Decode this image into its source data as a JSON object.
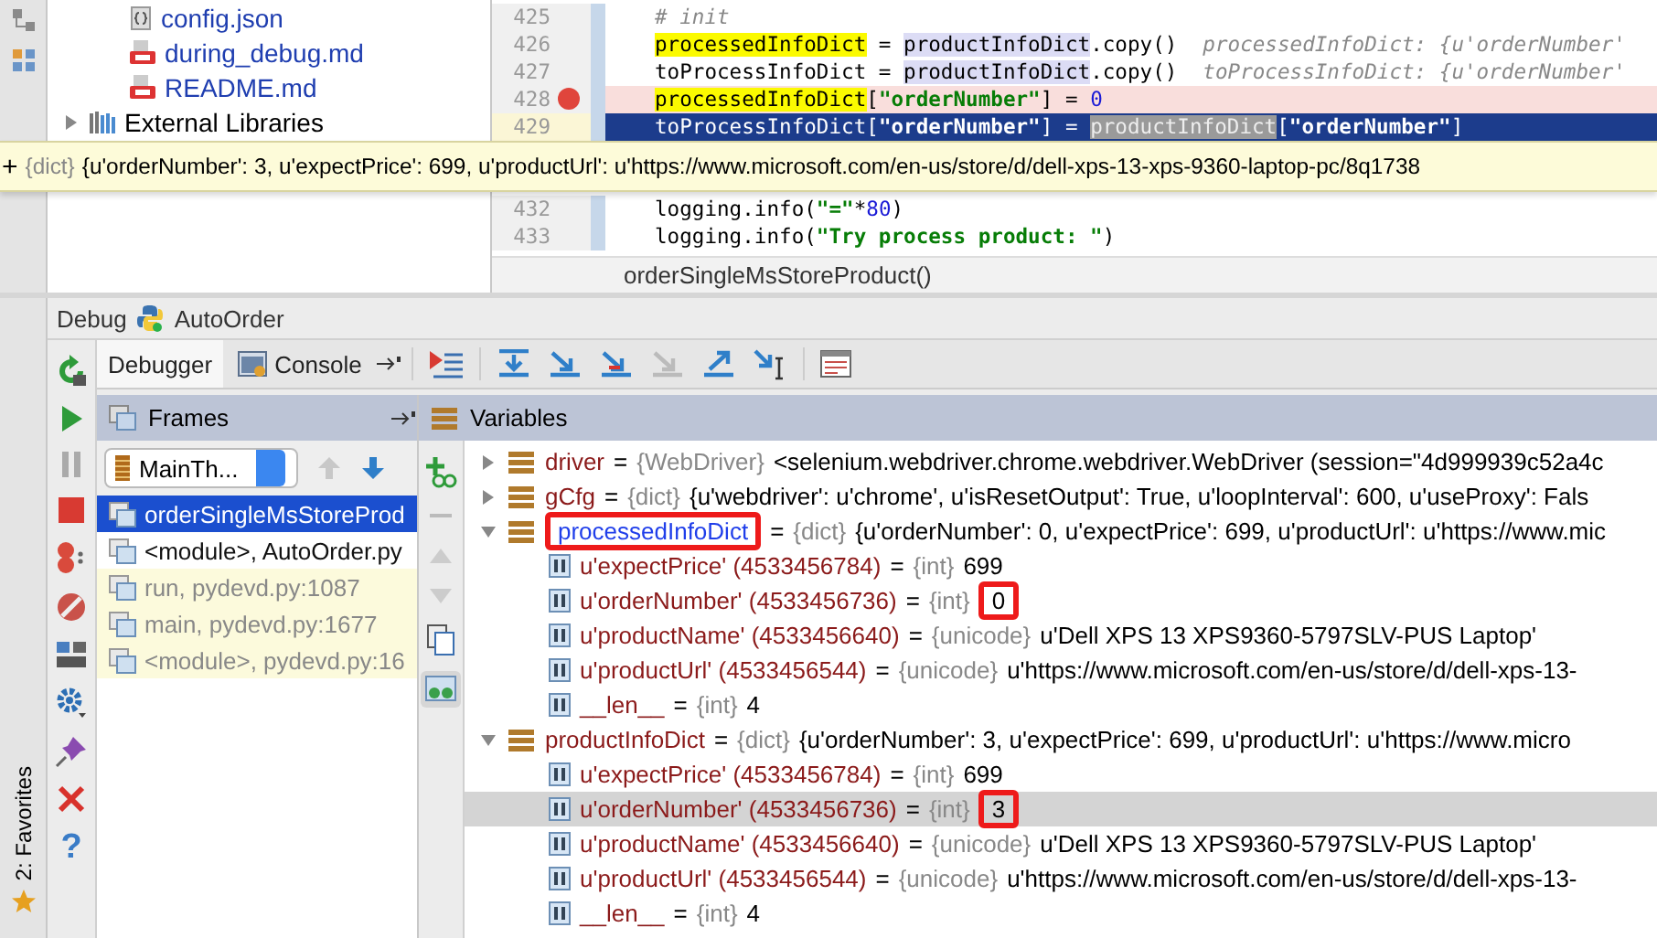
{
  "project_tree": {
    "items": [
      {
        "name": "config.json",
        "kind": "json",
        "modified": true
      },
      {
        "name": "during_debug.md",
        "kind": "md",
        "modified": true
      },
      {
        "name": "README.md",
        "kind": "md",
        "modified": true
      },
      {
        "name": "External Libraries",
        "kind": "library",
        "modified": false,
        "expanded": false
      }
    ]
  },
  "editor": {
    "lines": [
      {
        "number": "425",
        "breakpoint": false,
        "current": false,
        "segments": [
          {
            "text": "# init",
            "kind": "comment"
          }
        ]
      },
      {
        "number": "426",
        "breakpoint": false,
        "current": false,
        "segments": [
          {
            "text": "processedInfoDict",
            "kind": "assign"
          },
          {
            "text": " = ",
            "kind": "plain"
          },
          {
            "text": "productInfoDict",
            "kind": "ref"
          },
          {
            "text": ".copy()",
            "kind": "plain"
          },
          {
            "text": "processedInfoDict: {u'orderNumber'",
            "kind": "hint"
          }
        ]
      },
      {
        "number": "427",
        "breakpoint": false,
        "current": false,
        "segments": [
          {
            "text": "toProcessInfoDict",
            "kind": "plain"
          },
          {
            "text": " = ",
            "kind": "plain"
          },
          {
            "text": "productInfoDict",
            "kind": "ref"
          },
          {
            "text": ".copy()",
            "kind": "plain"
          },
          {
            "text": "toProcessInfoDict: {u'orderNumber'",
            "kind": "hint"
          }
        ]
      },
      {
        "number": "428",
        "breakpoint": true,
        "current": false,
        "segments": [
          {
            "text": "processedInfoDict",
            "kind": "assign"
          },
          {
            "text": "[",
            "kind": "plain"
          },
          {
            "text": "\"orderNumber\"",
            "kind": "str"
          },
          {
            "text": "] = ",
            "kind": "plain"
          },
          {
            "text": "0",
            "kind": "num"
          }
        ]
      },
      {
        "number": "429",
        "breakpoint": false,
        "current": true,
        "segments": [
          {
            "text": "toProcessInfoDict[",
            "kind": "plain"
          },
          {
            "text": "\"orderNumber\"",
            "kind": "str"
          },
          {
            "text": "] = ",
            "kind": "plain"
          },
          {
            "text": "productInfoDict",
            "kind": "sel"
          },
          {
            "text": "[",
            "kind": "plain"
          },
          {
            "text": "\"orderNumber\"",
            "kind": "str"
          },
          {
            "text": "]",
            "kind": "plain"
          }
        ]
      },
      {
        "number": "432",
        "breakpoint": false,
        "current": false,
        "segments": [
          {
            "text": "logging.info(",
            "kind": "plain"
          },
          {
            "text": "\"=\"",
            "kind": "str"
          },
          {
            "text": "*",
            "kind": "plain"
          },
          {
            "text": "80",
            "kind": "num"
          },
          {
            "text": ")",
            "kind": "plain"
          }
        ]
      },
      {
        "number": "433",
        "breakpoint": false,
        "current": false,
        "segments": [
          {
            "text": "logging.info(",
            "kind": "plain"
          },
          {
            "text": "\"Try process product: \"",
            "kind": "str"
          },
          {
            "text": ")",
            "kind": "plain"
          }
        ]
      }
    ],
    "breadcrumb": "orderSingleMsStoreProduct()"
  },
  "tooltip": {
    "expander": "+",
    "type": "{dict}",
    "value": "{u'orderNumber': 3, u'expectPrice': 699, u'productUrl': u'https://www.microsoft.com/en-us/store/d/dell-xps-13-xps-9360-laptop-pc/8q1738"
  },
  "side_strip": {
    "favorites_label": "2: Favorites",
    "help_glyph": "?"
  },
  "debug": {
    "title": "Debug",
    "config": "AutoOrder",
    "tabs": [
      {
        "label": "Debugger",
        "selected": true
      },
      {
        "label": "Console",
        "selected": false
      }
    ],
    "frames": {
      "title": "Frames",
      "thread": "MainTh...",
      "items": [
        {
          "label": "orderSingleMsStoreProd",
          "selected": true,
          "library": false
        },
        {
          "label": "<module>, AutoOrder.py",
          "selected": false,
          "library": false
        },
        {
          "label": "run, pydevd.py:1087",
          "selected": false,
          "library": true
        },
        {
          "label": "main, pydevd.py:1677",
          "selected": false,
          "library": true
        },
        {
          "label": "<module>, pydevd.py:16",
          "selected": false,
          "library": true
        }
      ]
    },
    "variables": {
      "title": "Variables",
      "items": [
        {
          "name": "driver",
          "eq": "=",
          "type": "{WebDriver}",
          "value": "<selenium.webdriver.chrome.webdriver.WebDriver (session=\"4d999939c52a4c",
          "expanded": false,
          "changed": false,
          "name_boxed": false
        },
        {
          "name": "gCfg",
          "eq": "=",
          "type": "{dict}",
          "value": "{u'webdriver': u'chrome', u'isResetOutput': True, u'loopInterval': 600, u'useProxy': Fals",
          "expanded": false,
          "changed": false,
          "name_boxed": false
        },
        {
          "name": "processedInfoDict",
          "eq": "=",
          "type": "{dict}",
          "value": "{u'orderNumber': 0, u'expectPrice': 699, u'productUrl': u'https://www.mic",
          "expanded": true,
          "changed": true,
          "name_boxed": true,
          "children": [
            {
              "name": "u'expectPrice' (4533456784)",
              "eq": "=",
              "type": "{int}",
              "value": "699",
              "selected": false,
              "value_boxed": false
            },
            {
              "name": "u'orderNumber' (4533456736)",
              "eq": "=",
              "type": "{int}",
              "value": "0",
              "selected": false,
              "value_boxed": true
            },
            {
              "name": "u'productName' (4533456640)",
              "eq": "=",
              "type": "{unicode}",
              "value": "u'Dell XPS 13 XPS9360-5797SLV-PUS Laptop'",
              "selected": false,
              "value_boxed": false
            },
            {
              "name": "u'productUrl' (4533456544)",
              "eq": "=",
              "type": "{unicode}",
              "value": "u'https://www.microsoft.com/en-us/store/d/dell-xps-13-",
              "selected": false,
              "value_boxed": false
            },
            {
              "name": "__len__",
              "eq": "=",
              "type": "{int}",
              "value": "4",
              "selected": false,
              "value_boxed": false
            }
          ]
        },
        {
          "name": "productInfoDict",
          "eq": "=",
          "type": "{dict}",
          "value": "{u'orderNumber': 3, u'expectPrice': 699, u'productUrl': u'https://www.micro",
          "expanded": true,
          "changed": false,
          "name_boxed": false,
          "children": [
            {
              "name": "u'expectPrice' (4533456784)",
              "eq": "=",
              "type": "{int}",
              "value": "699",
              "selected": false,
              "value_boxed": false
            },
            {
              "name": "u'orderNumber' (4533456736)",
              "eq": "=",
              "type": "{int}",
              "value": "3",
              "selected": true,
              "value_boxed": true
            },
            {
              "name": "u'productName' (4533456640)",
              "eq": "=",
              "type": "{unicode}",
              "value": "u'Dell XPS 13 XPS9360-5797SLV-PUS Laptop'",
              "selected": false,
              "value_boxed": false
            },
            {
              "name": "u'productUrl' (4533456544)",
              "eq": "=",
              "type": "{unicode}",
              "value": "u'https://www.microsoft.com/en-us/store/d/dell-xps-13-",
              "selected": false,
              "value_boxed": false
            },
            {
              "name": "__len__",
              "eq": "=",
              "type": "{int}",
              "value": "4",
              "selected": false,
              "value_boxed": false
            }
          ]
        }
      ]
    }
  }
}
